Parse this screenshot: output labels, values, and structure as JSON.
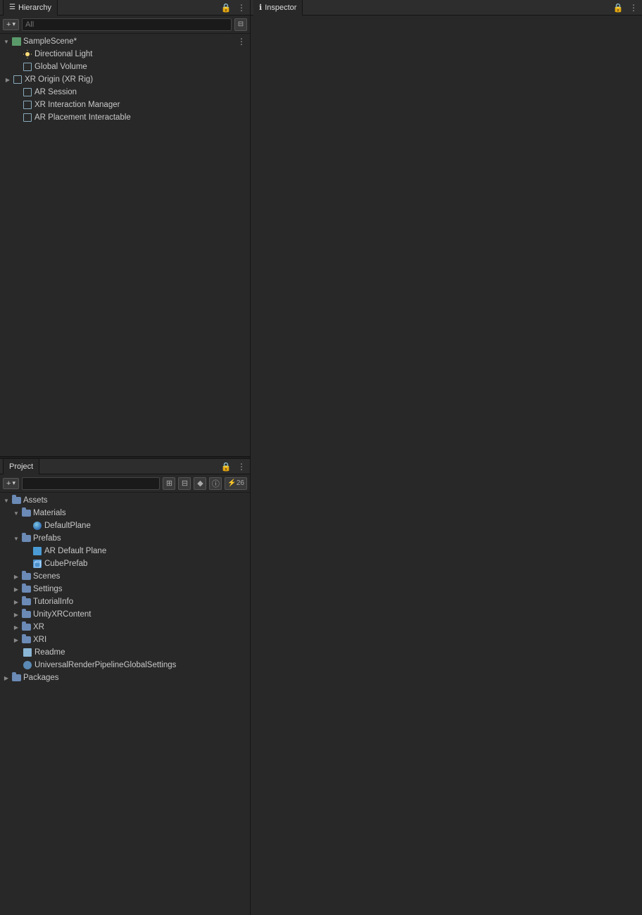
{
  "hierarchy_panel": {
    "tab_label": "Hierarchy",
    "lock_icon": "🔒",
    "more_icon": "⋮",
    "add_label": "+",
    "search_placeholder": "All",
    "filter_icon": "⊟",
    "scene": {
      "name": "SampleScene*",
      "children": [
        {
          "id": "directional-light",
          "name": "Directional Light",
          "icon": "light",
          "indent": 1
        },
        {
          "id": "global-volume",
          "name": "Global Volume",
          "icon": "gameobj",
          "indent": 1
        },
        {
          "id": "xr-origin",
          "name": "XR Origin (XR Rig)",
          "icon": "gameobj",
          "indent": 1,
          "hasChildren": true,
          "expanded": false
        },
        {
          "id": "ar-session",
          "name": "AR Session",
          "icon": "gameobj",
          "indent": 1
        },
        {
          "id": "xr-interaction-manager",
          "name": "XR Interaction Manager",
          "icon": "gameobj",
          "indent": 1
        },
        {
          "id": "ar-placement-interactable",
          "name": "AR Placement Interactable",
          "icon": "gameobj",
          "indent": 1
        }
      ]
    }
  },
  "inspector_panel": {
    "tab_label": "Inspector",
    "info_icon": "ℹ",
    "lock_icon": "🔒",
    "more_icon": "⋮"
  },
  "project_panel": {
    "tab_label": "Project",
    "lock_icon": "🔒",
    "more_icon": "⋮",
    "add_label": "+▾",
    "search_placeholder": "",
    "toolbar_icons": [
      "grid",
      "layout",
      "tag",
      "info"
    ],
    "badge_count": "26",
    "tree": [
      {
        "id": "assets",
        "name": "Assets",
        "type": "folder",
        "indent": 0,
        "expanded": true
      },
      {
        "id": "materials",
        "name": "Materials",
        "type": "folder",
        "indent": 1,
        "expanded": true
      },
      {
        "id": "defaultplane",
        "name": "DefaultPlane",
        "type": "material",
        "indent": 2
      },
      {
        "id": "prefabs",
        "name": "Prefabs",
        "type": "folder",
        "indent": 1,
        "expanded": true
      },
      {
        "id": "ar-default-plane",
        "name": "AR Default Plane",
        "type": "prefab",
        "indent": 2
      },
      {
        "id": "cube-prefab",
        "name": "CubePrefab",
        "type": "prefab-cube",
        "indent": 2
      },
      {
        "id": "scenes",
        "name": "Scenes",
        "type": "folder",
        "indent": 1,
        "expanded": false
      },
      {
        "id": "settings",
        "name": "Settings",
        "type": "folder",
        "indent": 1,
        "expanded": false
      },
      {
        "id": "tutorialinfo",
        "name": "TutorialInfo",
        "type": "folder",
        "indent": 1,
        "expanded": false
      },
      {
        "id": "unityxrcontent",
        "name": "UnityXRContent",
        "type": "folder",
        "indent": 1,
        "expanded": false
      },
      {
        "id": "xr",
        "name": "XR",
        "type": "folder",
        "indent": 1,
        "expanded": false
      },
      {
        "id": "xri",
        "name": "XRI",
        "type": "folder",
        "indent": 1,
        "expanded": false
      },
      {
        "id": "readme",
        "name": "Readme",
        "type": "readme",
        "indent": 1
      },
      {
        "id": "urp-settings",
        "name": "UniversalRenderPipelineGlobalSettings",
        "type": "urp",
        "indent": 1
      },
      {
        "id": "packages",
        "name": "Packages",
        "type": "folder",
        "indent": 0,
        "expanded": false
      }
    ]
  }
}
